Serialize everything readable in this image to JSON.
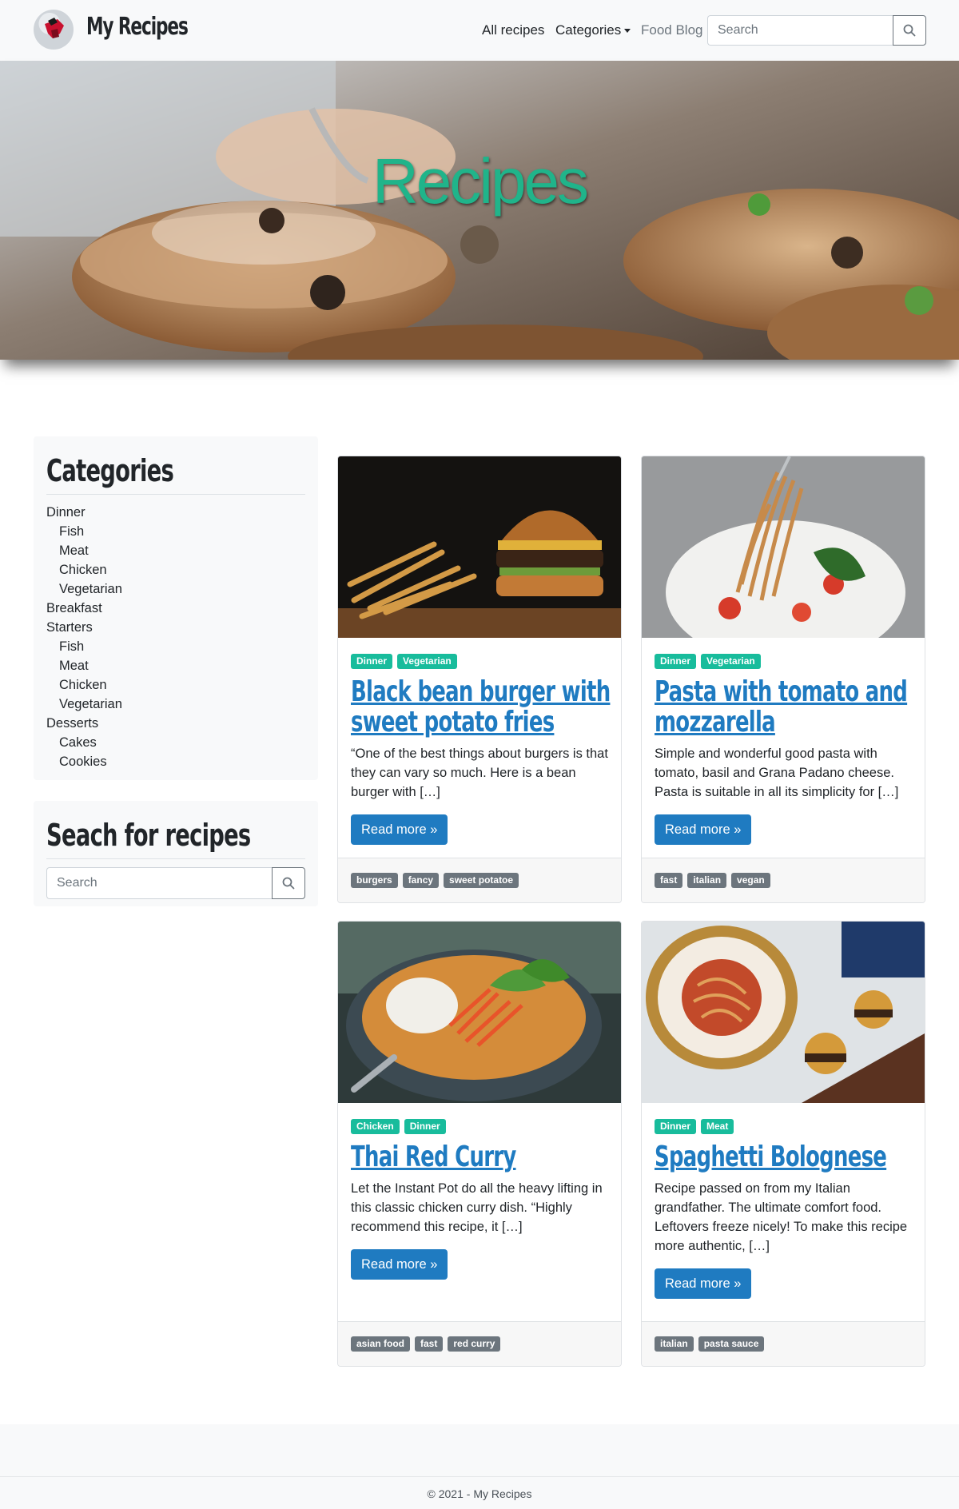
{
  "brand": {
    "name": "My Recipes"
  },
  "nav": {
    "all_recipes": "All recipes",
    "categories": "Categories",
    "food_blog": "Food Blog",
    "search_placeholder": "Search"
  },
  "hero": {
    "title": "Recipes"
  },
  "sidebar": {
    "categories_title": "Categories",
    "categories": [
      {
        "label": "Dinner",
        "level": 0
      },
      {
        "label": "Fish",
        "level": 1
      },
      {
        "label": "Meat",
        "level": 1
      },
      {
        "label": "Chicken",
        "level": 1
      },
      {
        "label": "Vegetarian",
        "level": 1
      },
      {
        "label": "Breakfast",
        "level": 0
      },
      {
        "label": "Starters",
        "level": 0
      },
      {
        "label": "Fish",
        "level": 1
      },
      {
        "label": "Meat",
        "level": 1
      },
      {
        "label": "Chicken",
        "level": 1
      },
      {
        "label": "Vegetarian",
        "level": 1
      },
      {
        "label": "Desserts",
        "level": 0
      },
      {
        "label": "Cakes",
        "level": 1
      },
      {
        "label": "Cookies",
        "level": 1
      }
    ],
    "search_title": "Seach for recipes",
    "search_placeholder": "Search"
  },
  "recipes": [
    {
      "categories": [
        "Dinner",
        "Vegetarian"
      ],
      "title": "Black bean burger with sweet potato fries",
      "excerpt": "“One of the best things about burgers is that they can vary so much. Here is a bean burger with […]",
      "read_more": "Read more »",
      "tags": [
        "burgers",
        "fancy",
        "sweet potatoe"
      ],
      "image": "burger-and-fries-photo"
    },
    {
      "categories": [
        "Dinner",
        "Vegetarian"
      ],
      "title": "Pasta with tomato and mozzarella",
      "excerpt": "Simple and wonderful good pasta with tomato, basil and Grana Padano cheese. Pasta is suitable in all its simplicity for […]",
      "read_more": "Read more »",
      "tags": [
        "fast",
        "italian",
        "vegan"
      ],
      "image": "pasta-on-fork-photo"
    },
    {
      "categories": [
        "Chicken",
        "Dinner"
      ],
      "title": "Thai Red Curry",
      "excerpt": "Let the Instant Pot do all the heavy lifting in this classic chicken curry dish. “Highly recommend this recipe, it […]",
      "read_more": "Read more »",
      "tags": [
        "asian food",
        "fast",
        "red curry"
      ],
      "image": "curry-bowl-photo"
    },
    {
      "categories": [
        "Dinner",
        "Meat"
      ],
      "title": "Spaghetti Bolognese",
      "excerpt": "Recipe passed on from my Italian grandfather. The ultimate comfort food. Leftovers freeze nicely! To make this recipe more authentic, […]",
      "read_more": "Read more »",
      "tags": [
        "italian",
        "pasta sauce"
      ],
      "image": "spaghetti-and-sliders-photo"
    }
  ],
  "footer": {
    "copyright": "© 2021 - My Recipes"
  },
  "colors": {
    "accent_green": "#18bc9c",
    "link_blue": "#1f7bc1",
    "tag_grey": "#6c757d",
    "hero_title": "#20b48a"
  }
}
